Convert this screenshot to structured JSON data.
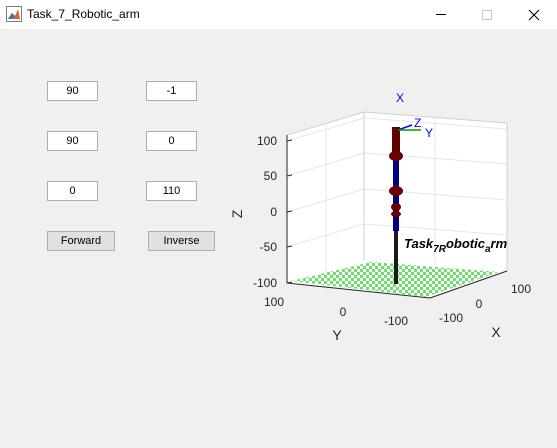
{
  "window": {
    "title": "Task_7_Robotic_arm",
    "icon": "matlab-figure-icon"
  },
  "controls": {
    "inputs": [
      {
        "value": "90"
      },
      {
        "value": "-1"
      },
      {
        "value": "90"
      },
      {
        "value": "0"
      },
      {
        "value": "0"
      },
      {
        "value": "110"
      }
    ],
    "forward_label": "Forward",
    "inverse_label": "Inverse"
  },
  "plot": {
    "z_label": "Z",
    "y_label": "Y",
    "x_label": "X",
    "z_ticks": [
      "100",
      "50",
      "0",
      "-50",
      "-100"
    ],
    "y_ticks": [
      "100",
      "0",
      "-100"
    ],
    "x_ticks": [
      "-100",
      "0",
      "100"
    ],
    "frame_labels": {
      "x": "X",
      "y": "Y",
      "z": "Z"
    },
    "annotation": {
      "base": "Task",
      "sub1": "7R",
      "mid": "obotic",
      "sub2": "a",
      "end": "rm"
    },
    "colors": {
      "link_dark": "#1a1a1a",
      "link_blue": "#000080",
      "link_red": "#600000",
      "joint": "#6b0000",
      "floor": "#6be06b",
      "frame_x": "#0000ff",
      "frame_y": "#00a000"
    }
  }
}
